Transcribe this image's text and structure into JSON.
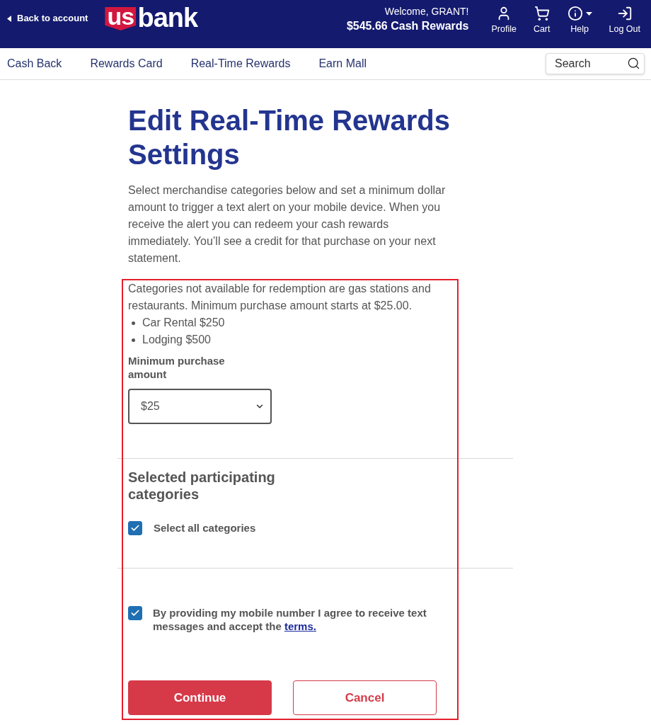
{
  "header": {
    "back_link": "Back to account",
    "logo": {
      "mark": "us",
      "wordmark": "bank"
    },
    "welcome": "Welcome, GRANT!",
    "rewards_balance": "$545.66 Cash Rewards",
    "actions": [
      {
        "kind": "profile",
        "label": "Profile",
        "has_menu": false
      },
      {
        "kind": "cart",
        "label": "Cart",
        "has_menu": false
      },
      {
        "kind": "help",
        "label": "Help",
        "has_menu": true
      },
      {
        "kind": "logout",
        "label": "Log Out",
        "has_menu": false
      }
    ]
  },
  "nav": {
    "items": [
      {
        "label": "Cash Back"
      },
      {
        "label": "Rewards Card"
      },
      {
        "label": "Real-Time Rewards"
      },
      {
        "label": "Earn Mall"
      }
    ],
    "search": {
      "placeholder": "Search"
    }
  },
  "page": {
    "title": "Edit Real-Time Rewards Settings",
    "intro": "Select merchandise categories below and set a minimum dollar amount to trigger a text alert on your mobile device. When you receive the alert you can redeem your cash rewards immediately. You’ll see a credit for that purchase on your next statement."
  },
  "form": {
    "highlighted": true,
    "note": "Categories not available for redemption are gas stations and restaurants. Minimum purchase amount starts at $25.00.",
    "exceptions": [
      "Car Rental $250",
      "Lodging $500"
    ],
    "minimum_amount": {
      "label": "Minimum purchase amount",
      "value": "$25"
    },
    "categories": {
      "heading": "Selected participating categories",
      "select_all": {
        "label": "Select all categories",
        "checked": true
      }
    },
    "consent": {
      "text": "By providing my mobile number I agree to receive text messages and accept the",
      "link": "terms.",
      "checked": true
    },
    "buttons": [
      {
        "kind": "primary",
        "label": "Continue"
      },
      {
        "kind": "secondary",
        "label": "Cancel"
      }
    ]
  }
}
